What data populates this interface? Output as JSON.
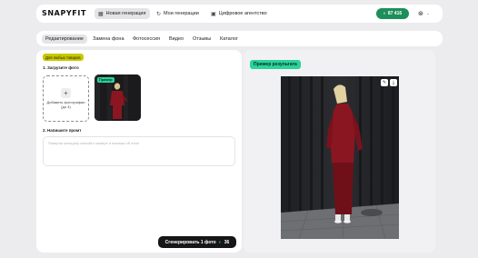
{
  "header": {
    "logo": "SNAPYFIT",
    "nav": [
      {
        "label": "Новая генерация",
        "icon": "grid-icon",
        "active": true
      },
      {
        "label": "Мои генерации",
        "icon": "history-icon",
        "active": false
      },
      {
        "label": "Цифровое агентство",
        "icon": "store-icon",
        "active": false
      }
    ],
    "balance": "87 416",
    "user_icon": "user-avatar-icon"
  },
  "tabs": [
    "Редактирование",
    "Замена фона",
    "Фотосессия",
    "Видео",
    "Отзывы",
    "Каталог"
  ],
  "active_tab": 0,
  "left": {
    "badge": "Для любых товаров",
    "step1": "1. Загрузите фото",
    "upload_label": "Добавить фотографии (до 4)",
    "thumb_badge": "Пример",
    "step2": "2. Напишите промт",
    "prompt_placeholder": "Поверни женщину спиной к камере и напиши об этом",
    "generate_label": "Сгенерировать 1 фото",
    "generate_cost": "36"
  },
  "right": {
    "badge": "Пример результата"
  },
  "colors": {
    "accent_green": "#2bd39a",
    "balance_green": "#1d8f5a",
    "badge_yellow": "#c9c800",
    "dark_button": "#161618",
    "suit_red": "#8a1622"
  }
}
